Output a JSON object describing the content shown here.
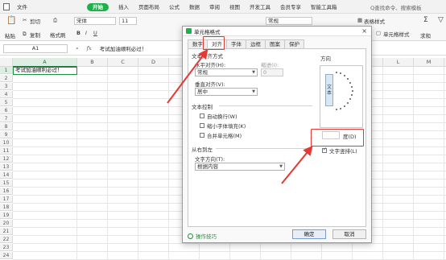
{
  "menubar": {
    "items": [
      "文件",
      "开始",
      "插入",
      "页面布局",
      "公式",
      "数据",
      "审阅",
      "视图",
      "开发工具",
      "会员专享",
      "智能工具箱"
    ],
    "active_index": 1,
    "search_text": "Q查找命令、搜索模板"
  },
  "toolbar": {
    "paste": "粘贴",
    "cut": "剪切",
    "copy": "复制",
    "format_painter": "格式刷",
    "font_name": "宋体",
    "font_size": "11",
    "align_format": "常规",
    "table_style": "表格样式",
    "cell_style": "单元格样式",
    "sum": "求和",
    "filter": "筛选"
  },
  "formula_bar": {
    "name_box": "A1",
    "fx": "fx",
    "content": "考试加油顺利必过！"
  },
  "grid": {
    "columns": [
      "A",
      "B",
      "C",
      "D",
      "E",
      "F",
      "G",
      "H",
      "I",
      "J",
      "K",
      "L",
      "M",
      "N"
    ],
    "rows": [
      "1",
      "2",
      "3",
      "4",
      "5",
      "6",
      "7",
      "8",
      "9",
      "10",
      "11",
      "12",
      "13",
      "14",
      "15",
      "16",
      "17",
      "18",
      "19",
      "20",
      "21",
      "22",
      "23",
      "24",
      "25"
    ],
    "cell_a1": "考试加油顺利必过！"
  },
  "dialog": {
    "title": "单元格格式",
    "close": "×",
    "tabs": [
      "数字",
      "对齐",
      "字体",
      "边框",
      "图案",
      "保护"
    ],
    "active_tab": "对齐",
    "text_alignment": "文本对齐方式",
    "horizontal_label": "水平对齐(H):",
    "horizontal_value": "常规",
    "indent_label": "缩进(I):",
    "indent_value": "0",
    "vertical_label": "垂直对齐(V):",
    "vertical_value": "居中",
    "text_control": "文本控制",
    "wrap_text": "自动换行(W)",
    "shrink_to_fit": "缩小字体填充(K)",
    "merge_cells": "合并单元格(M)",
    "rtl": "从右到左",
    "text_direction_label": "文字方向(T):",
    "text_direction_value": "根据内容",
    "orientation": "方向",
    "vertical_text": [
      "文",
      "本"
    ],
    "degree_value": "",
    "degree_label": "度(D)",
    "vertical_text_check": "文字竖排(L)",
    "tips": "操作技巧",
    "ok": "确定",
    "cancel": "取消"
  },
  "annotation_color": "#e53935",
  "accent_color": "#1eb14b"
}
